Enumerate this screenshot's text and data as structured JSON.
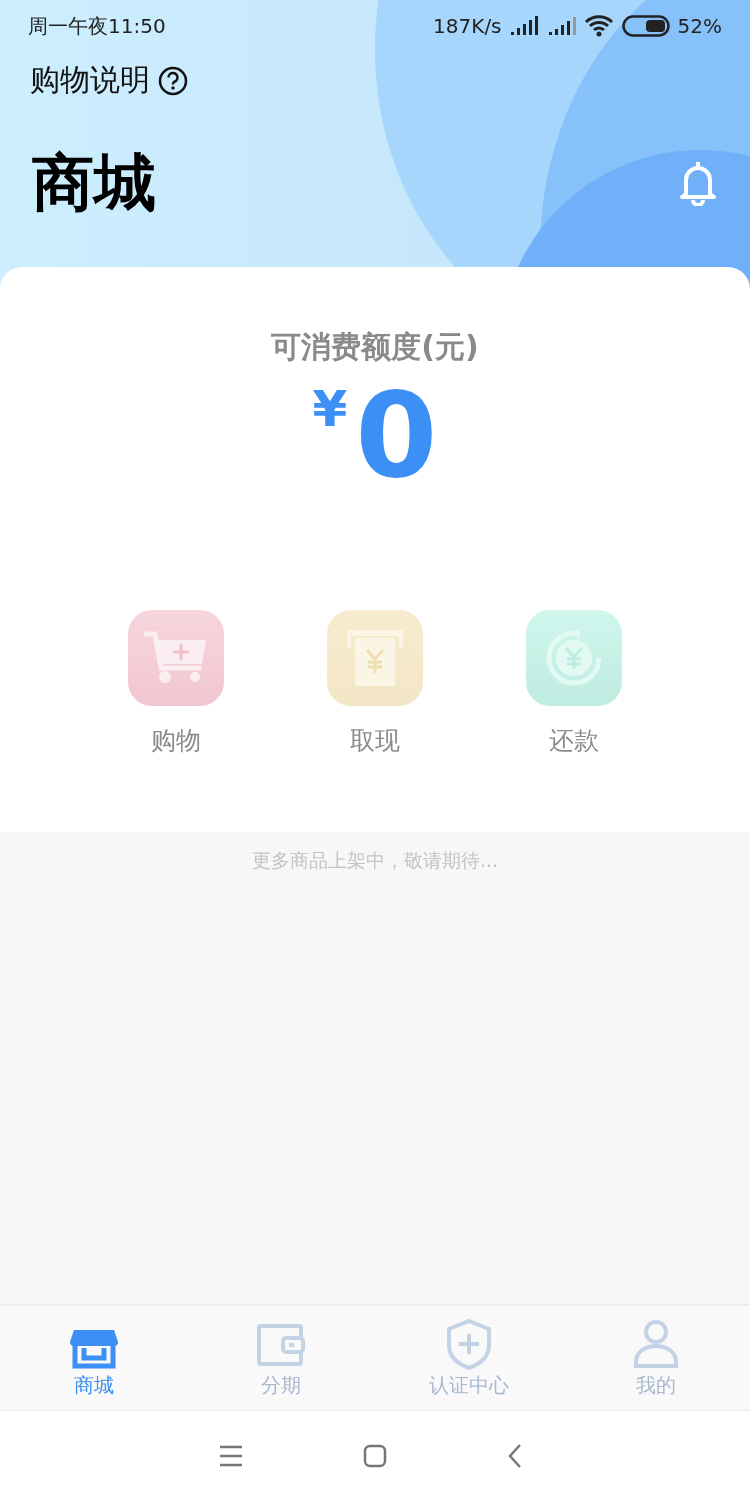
{
  "status_bar": {
    "time": "周一午夜11:50",
    "net_speed": "187K/s",
    "battery": "52%"
  },
  "header": {
    "help_link": "购物说明",
    "title": "商城"
  },
  "balance": {
    "label": "可消费额度(元)",
    "currency": "¥",
    "amount": "0"
  },
  "actions": [
    {
      "kind": "cart",
      "label": "购物"
    },
    {
      "kind": "atm",
      "label": "取现"
    },
    {
      "kind": "repay",
      "label": "还款"
    }
  ],
  "notice": "更多商品上架中，敬请期待...",
  "tabs": [
    {
      "kind": "shop",
      "label": "商城",
      "selected": true
    },
    {
      "kind": "wallet",
      "label": "分期",
      "selected": false
    },
    {
      "kind": "shield",
      "label": "认证中心",
      "selected": false
    },
    {
      "kind": "person",
      "label": "我的",
      "selected": false
    }
  ]
}
